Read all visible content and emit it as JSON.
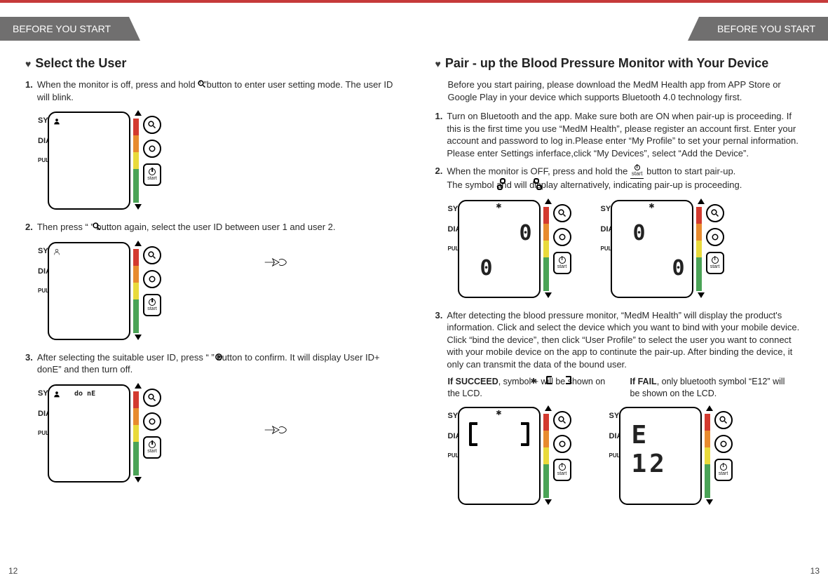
{
  "header": {
    "left": "BEFORE YOU START",
    "right": "BEFORE YOU START"
  },
  "pages": {
    "left": "12",
    "right": "13"
  },
  "left": {
    "heading": "Select the User",
    "step1_num": "1.",
    "step1": "When the monitor is off, press and hold “       ”button to enter user setting mode. The user ID will blink.",
    "step2_num": "2.",
    "step2": "Then press “       ” button again, select the user ID between user 1 and user 2.",
    "step3_num": "3.",
    "step3": "After selecting the suitable user ID, press “       ” button to confirm. It will display User ID+ donE” and then turn off.",
    "done_label": "do nE"
  },
  "right": {
    "heading": "Pair - up the Blood Pressure Monitor with Your Device",
    "intro": "Before you start pairing, please download the MedM Health app from APP Store or Google Play in your device which supports Bluetooth 4.0 technology first.",
    "step1_num": "1.",
    "step1": "Turn on Bluetooth and the app. Make sure both are ON when pair-up is proceeding. If this is the first time you use “MedM Health”, please register an account first. Enter your account and password to log in.Please enter “My Profile” to set your pernal information. Please enter Settings inferface,click “My Devices”, select “Add the Device”.",
    "step2_num": "2.",
    "step2a": "When the monitor is OFF, press and hold the ",
    "step2b": " button to start pair-up.",
    "step2c": "The symbol       and       will display alternatively, indicating pair-up is proceeding.",
    "step3_num": "3.",
    "step3": "After detecting the blood pressure monitor, “MedM Health” will display the product's information. Click and select the device which you want to bind with your mobile device. Click “bind the device”, then click “User Profile” to select the user you want to connect with your mobile device on the app to continute the pair-up. After binding the device, it only can transmit the data of the bound user.",
    "succeed_bold": "If SUCCEED",
    "succeed": ", symbol      +             will be shown on the LCD.",
    "fail_bold": "If FAIL",
    "fail": ", only bluetooth symbol “E12” will be shown on the LCD.",
    "e12": "E 12"
  },
  "device_labels": {
    "sys": "SYS",
    "dia": "DIA",
    "pulse": "PULSE"
  },
  "buttons": {
    "start": "start"
  },
  "icons": {
    "bt": "✱",
    "power": "⏻"
  }
}
